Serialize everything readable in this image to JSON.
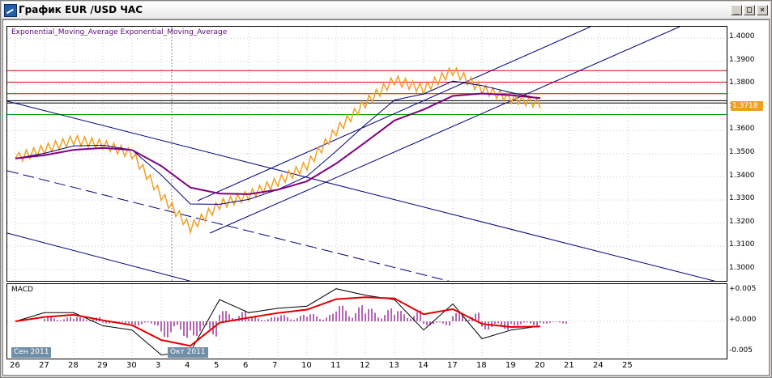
{
  "window": {
    "title": "График EUR /USD ЧАС",
    "buttons": {
      "minimize": "_",
      "maximize": "□",
      "close": "×"
    }
  },
  "indicators": {
    "main_label": "Exponential_Moving_Average Exponential_Moving_Average",
    "macd_label": "MACD"
  },
  "price_axis": {
    "ticks": [
      "1.4000",
      "1.3900",
      "1.3800",
      "1.3700",
      "1.3600",
      "1.3500",
      "1.3400",
      "1.3300",
      "1.3200",
      "1.3100",
      "1.3000"
    ],
    "current_price": "1.3718"
  },
  "macd_axis": {
    "ticks": [
      "+0.005",
      "+0.000",
      "-0.005"
    ]
  },
  "time_axis": {
    "labels": [
      "26",
      "27",
      "28",
      "29",
      "30",
      "3",
      "4",
      "5",
      "6",
      "7",
      "10",
      "11",
      "12",
      "13",
      "14",
      "17",
      "18",
      "19",
      "20",
      "21",
      "24",
      "25"
    ],
    "months": [
      "Сен 2011",
      "Окт 2011"
    ]
  },
  "colors": {
    "price": "#f0a020",
    "ema_fast": "#000080",
    "ema_slow": "#800080",
    "macd_line": "#000000",
    "macd_signal": "#e00000",
    "histogram": "#800080",
    "channel": "#000080",
    "resistance": "#e00000",
    "support": "#00a000"
  },
  "chart_data": {
    "type": "line",
    "x": [
      "26",
      "27",
      "28",
      "29",
      "30",
      "3",
      "4",
      "5",
      "6",
      "7",
      "10",
      "11",
      "12",
      "13",
      "14",
      "17",
      "18",
      "19",
      "20"
    ],
    "series": [
      {
        "values": [
          1.348,
          1.352,
          1.356,
          1.354,
          1.35,
          1.332,
          1.318,
          1.328,
          1.332,
          1.338,
          1.345,
          1.36,
          1.372,
          1.382,
          1.378,
          1.386,
          1.378,
          1.374,
          1.3718
        ]
      }
    ],
    "hlines": [
      1.386,
      1.381,
      1.376,
      1.373,
      1.372,
      1.367
    ],
    "ylim": [
      1.295,
      1.405
    ],
    "macd": {
      "ylim": [
        -0.006,
        0.006
      ]
    }
  }
}
